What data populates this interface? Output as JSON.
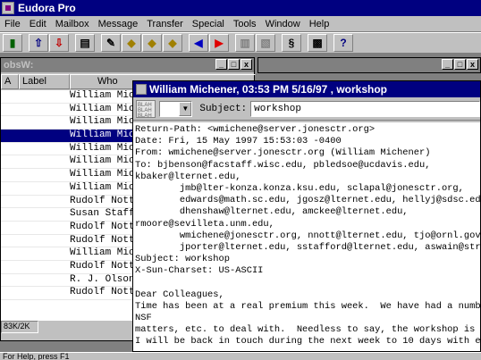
{
  "app": {
    "title": "Eudora Pro"
  },
  "menu": [
    "File",
    "Edit",
    "Mailbox",
    "Message",
    "Transfer",
    "Special",
    "Tools",
    "Window",
    "Help"
  ],
  "mailbox": {
    "title": "obsW:",
    "col_sort": "A",
    "col_label": "Label",
    "col_who": "Who",
    "count": "83K/2K",
    "rows": [
      "William Mic",
      "William Mic",
      "William Mic",
      "William Mic",
      "William Mic",
      "William Mic",
      "William Mic",
      "William Mic",
      "Rudolf Nott",
      "Susan Staff",
      "Rudolf Nott",
      "Rudolf Nott",
      "William Mic",
      "Rudolf Nott",
      "R. J. Olson",
      "Rudolf Nott"
    ]
  },
  "message": {
    "title": "William Michener, 03:53 PM 5/16/97 , workshop",
    "subject_label": "Subject:",
    "subject": "workshop",
    "lines": [
      "Return-Path: <wmichene@server.jonesctr.org>",
      "Date: Fri, 15 May 1997 15:53:03 -0400",
      "From: wmichene@server.jonesctr.org (William Michener)",
      "To: bjbenson@facstaff.wisc.edu, pbledsoe@ucdavis.edu,",
      "kbaker@lternet.edu,",
      "        jmb@lter-konza.konza.ksu.edu, sclapal@jonesctr.org,",
      "        edwards@math.sc.edu, jgosz@lternet.edu, hellyj@sdsc.edu,",
      "        dhenshaw@lternet.edu, amckee@lternet.edu,",
      "rmoore@sevilleta.unm.edu,",
      "        wmichene@jonesctr.org, nnott@lternet.edu, tjo@ornl.gov,",
      "        jporter@lternet.edu, sstafford@lternet.edu, aswain@strat",
      "Subject: workshop",
      "X-Sun-Charset: US-ASCII",
      "",
      "Dear Colleagues,",
      "Time has been at a real premium this week.  We have had a number",
      "NSF",
      "matters, etc. to deal with.  Needless to say, the workshop is a",
      "I will be back in touch during the next week to 10 days with ea"
    ]
  },
  "status": "For Help, press F1"
}
